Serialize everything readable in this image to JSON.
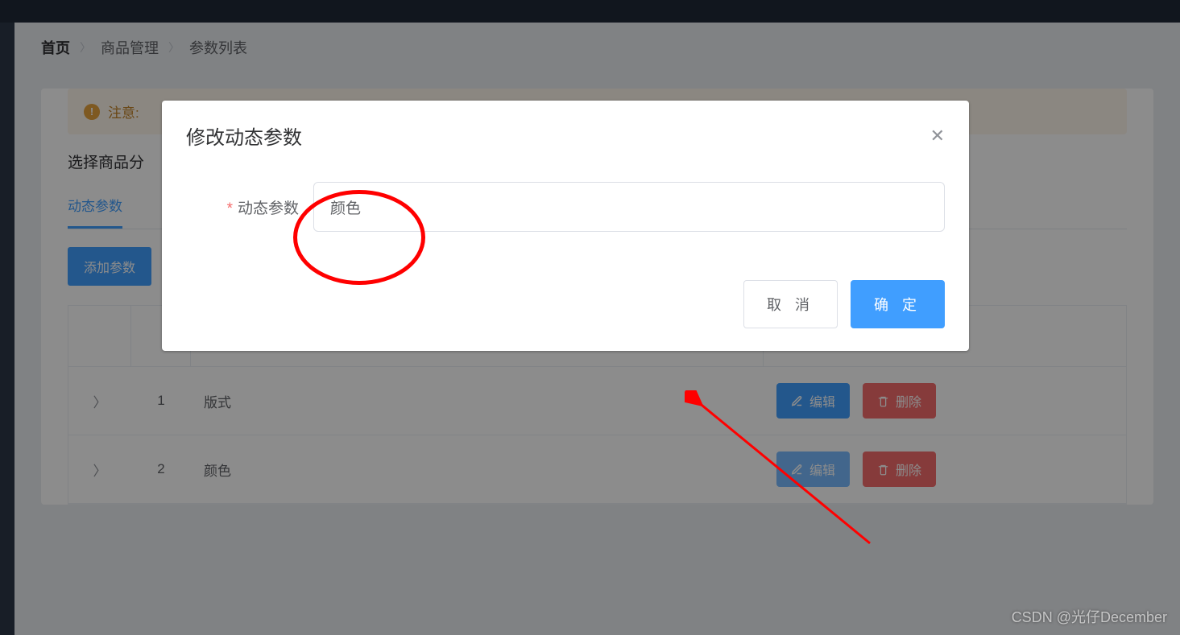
{
  "breadcrumb": {
    "home": "首页",
    "item1": "商品管理",
    "item2": "参数列表"
  },
  "alert": {
    "prefix": "注意:"
  },
  "section_label": "选择商品分",
  "tabs": {
    "active": "动态参数"
  },
  "buttons": {
    "add": "添加参数",
    "edit": "编辑",
    "delete": "删除"
  },
  "table": {
    "rows": [
      {
        "index": "1",
        "name": "版式"
      },
      {
        "index": "2",
        "name": "颜色"
      }
    ]
  },
  "dialog": {
    "title": "修改动态参数",
    "field_label": "动态参数",
    "field_value": "颜色",
    "cancel": "取 消",
    "confirm": "确 定"
  },
  "watermark": "CSDN @光仔December"
}
